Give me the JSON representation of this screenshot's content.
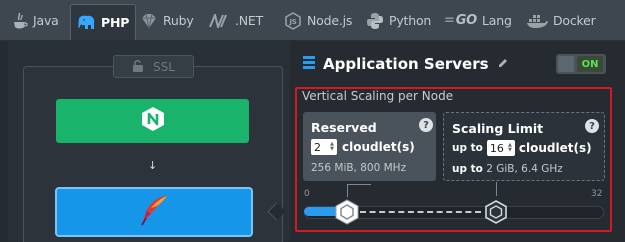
{
  "tabs": [
    {
      "label": "Java",
      "icon": "java-icon",
      "active": false
    },
    {
      "label": "PHP",
      "icon": "php-elephant-icon",
      "active": true
    },
    {
      "label": "Ruby",
      "icon": "ruby-icon",
      "active": false
    },
    {
      "label": ".NET",
      "icon": "dotnet-icon",
      "active": false
    },
    {
      "label": "Node.js",
      "icon": "nodejs-icon",
      "active": false
    },
    {
      "label": "Python",
      "icon": "python-icon",
      "active": false
    },
    {
      "label": "Lang",
      "icon": "go-icon",
      "icon_text": "GO",
      "active": false
    },
    {
      "label": "Docker",
      "icon": "docker-icon",
      "active": false
    }
  ],
  "topology": {
    "ssl_label": "SSL",
    "balancer_icon": "nginx-icon",
    "server_icon": "apache-feather-icon",
    "arrow": "↓"
  },
  "app_servers": {
    "title": "Application Servers",
    "toggle_label": "ON",
    "vertical_scaling_title": "Vertical Scaling per Node",
    "reserved": {
      "title": "Reserved",
      "value": "2",
      "unit": "cloudlet(s)",
      "info": "256 MiB, 800 MHz"
    },
    "limit": {
      "title": "Scaling Limit",
      "prefix": "up to",
      "value": "16",
      "unit": "cloudlet(s)",
      "info_prefix": "up to",
      "info": "2 GiB, 6.4 GHz"
    },
    "slider": {
      "min_label": "0",
      "max_label": "32",
      "min": 0,
      "max": 32,
      "reserved": 2,
      "limit": 16
    }
  },
  "colors": {
    "accent_blue": "#1596e8",
    "nginx_green": "#19b36b",
    "highlight_red": "#d11b24",
    "toggle_on": "#57e35b"
  }
}
